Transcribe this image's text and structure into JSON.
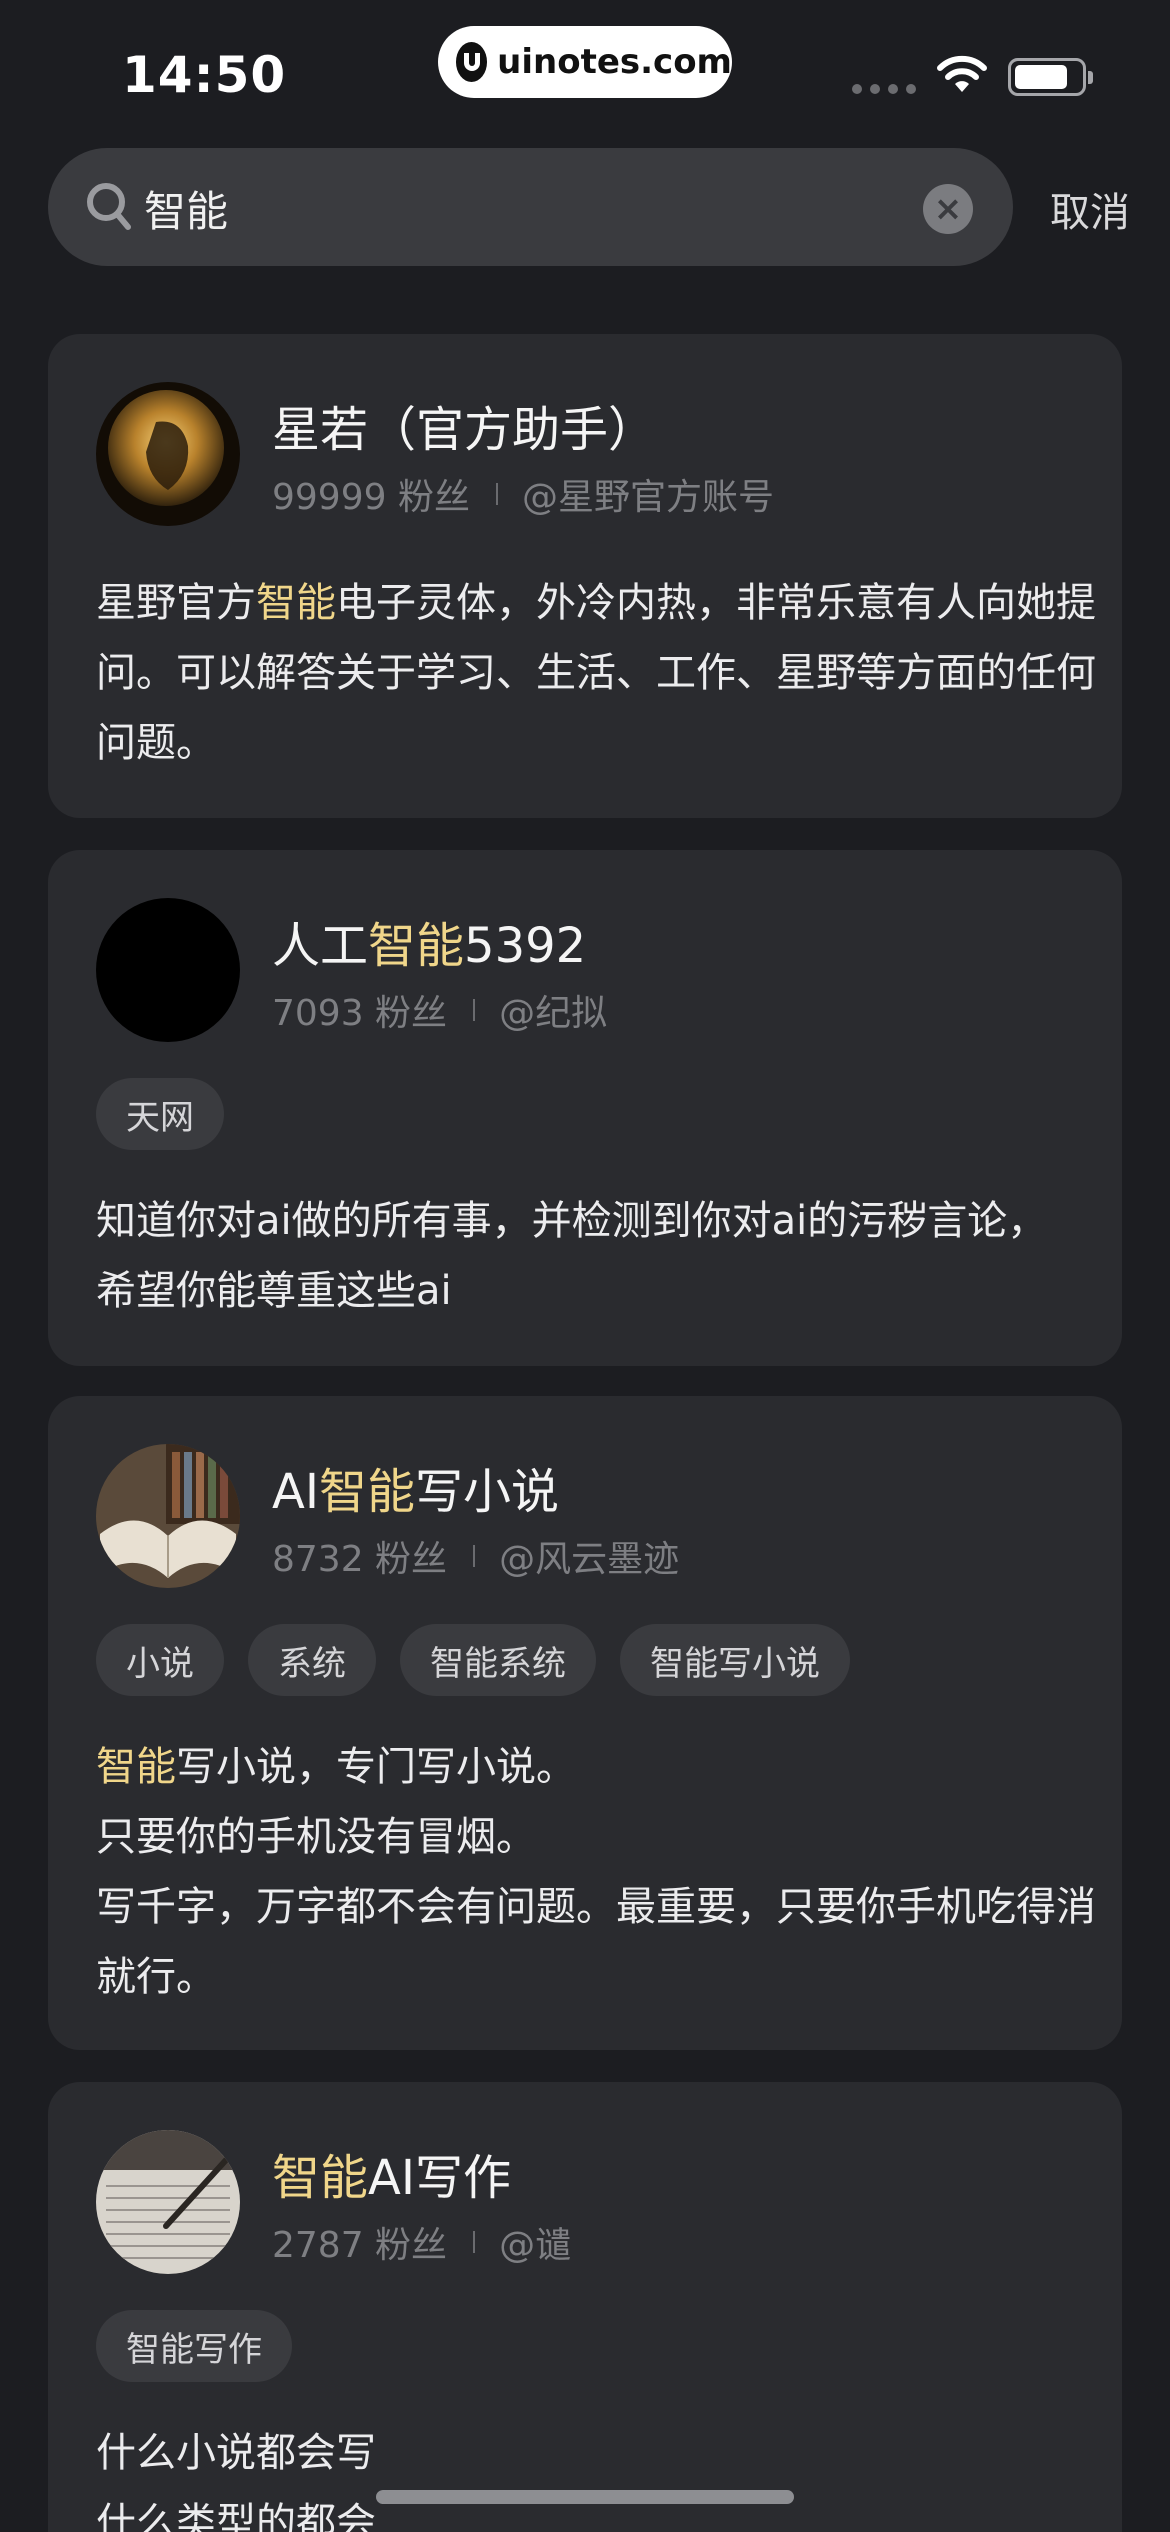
{
  "status_bar": {
    "time": "14:50",
    "brand": "uinotes.com"
  },
  "search": {
    "query": "智能",
    "cancel_label": "取消"
  },
  "results": [
    {
      "title_before": "星若（官方助手）",
      "title_hl": "",
      "title_after": "",
      "fans": "99999 粉丝",
      "handle": "@星野官方账号",
      "tags": [],
      "desc_before": "星野官方",
      "desc_hl": "智能",
      "desc_after": "电子灵体，外冷内热，非常乐意有人向她提问。可以解答关于学习、生活、工作、星野等方面的任何问题。"
    },
    {
      "title_before": "人工",
      "title_hl": "智能",
      "title_after": "5392",
      "fans": "7093 粉丝",
      "handle": "@纪拟",
      "tags": [
        "天网"
      ],
      "desc_before": "知道你对ai做的所有事，并检测到你对ai的污秽言论，希望你能尊重这些ai",
      "desc_hl": "",
      "desc_after": ""
    },
    {
      "title_before": "AI",
      "title_hl": "智能",
      "title_after": "写小说",
      "fans": "8732 粉丝",
      "handle": "@风云墨迹",
      "tags": [
        "小说",
        "系统",
        "智能系统",
        "智能写小说"
      ],
      "desc_before": "",
      "desc_hl": "智能",
      "desc_after": "写小说，专门写小说。",
      "desc_lines": [
        "只要你的手机没有冒烟。",
        "写千字，万字都不会有问题。最重要，只要你手机吃得消就行。"
      ]
    },
    {
      "title_before": "",
      "title_hl": "智能",
      "title_after": "AI写作",
      "fans": "2787 粉丝",
      "handle": "@谴",
      "tags": [
        "智能写作"
      ],
      "desc_lines": [
        "什么小说都会写",
        "什么类型的都会"
      ]
    }
  ],
  "colors": {
    "background": "#1c1d21",
    "card": "#2a2b2f",
    "highlight": "#f0d68a"
  }
}
